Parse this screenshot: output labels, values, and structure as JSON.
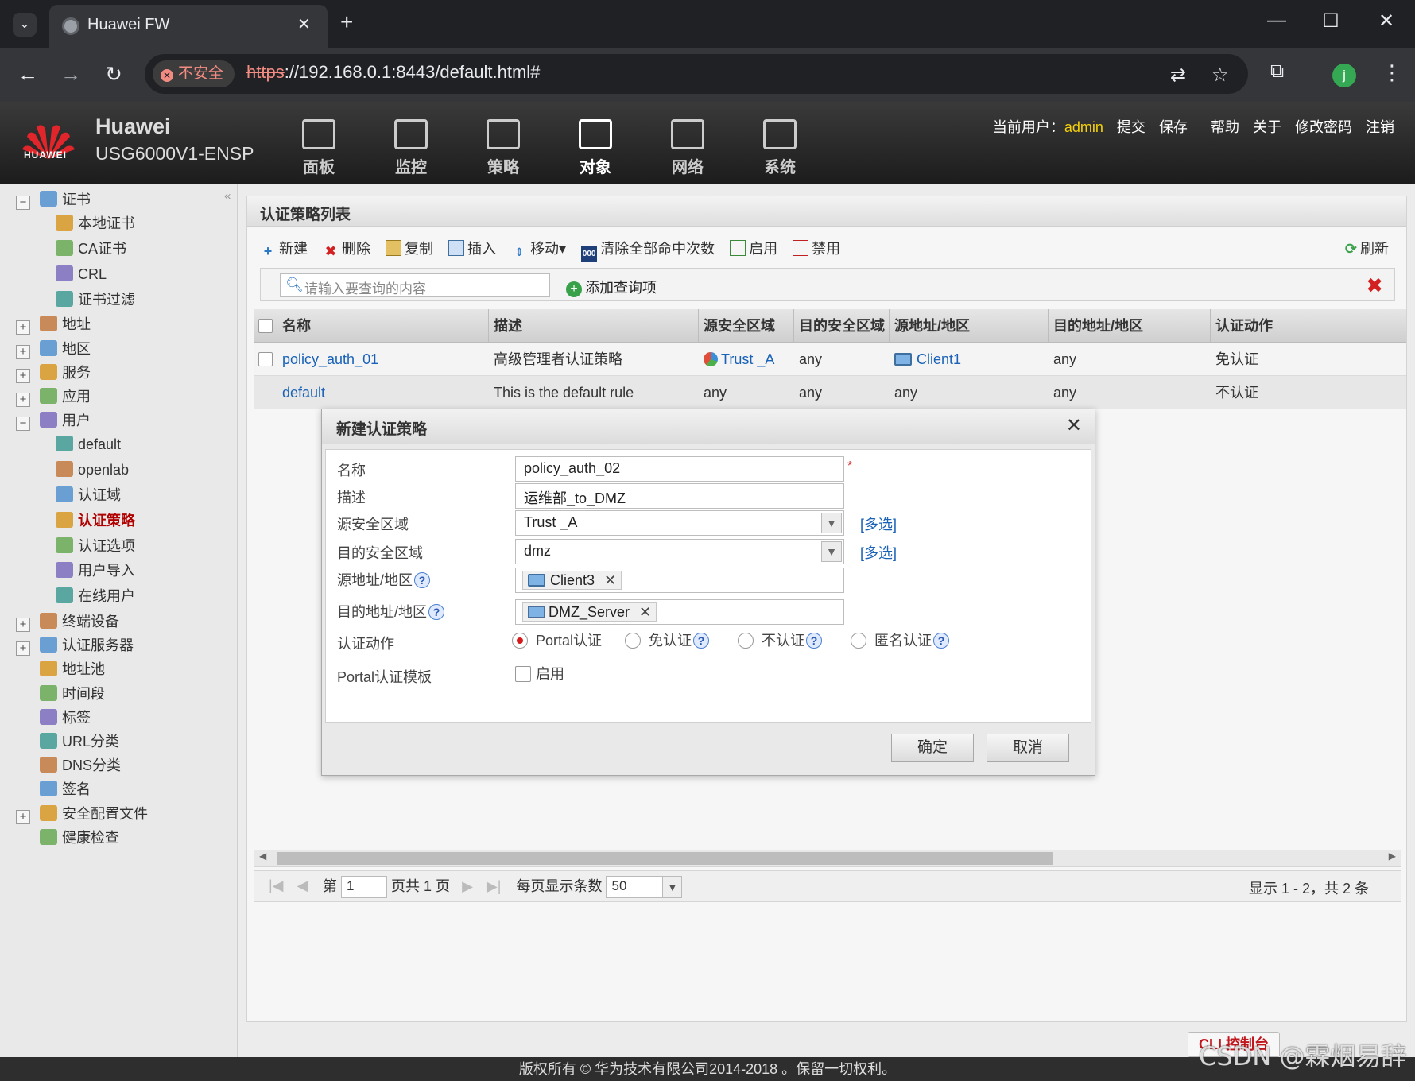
{
  "browser": {
    "tab_title": "Huawei FW",
    "new_tab": "+",
    "security_label": "不安全",
    "url_scheme": "https",
    "url_rest": "://192.168.0.1:8443/default.html#",
    "avatar_letter": "j"
  },
  "header": {
    "logo_text": "HUAWEI",
    "brand_line1": "Huawei",
    "brand_line2": "USG6000V1-ENSP",
    "menu": [
      {
        "label": "面板",
        "icon": "dashboard-icon"
      },
      {
        "label": "监控",
        "icon": "monitor-icon"
      },
      {
        "label": "策略",
        "icon": "policy-icon"
      },
      {
        "label": "对象",
        "icon": "object-icon",
        "active": true
      },
      {
        "label": "网络",
        "icon": "network-icon"
      },
      {
        "label": "系统",
        "icon": "system-icon"
      }
    ],
    "current_user_label": "当前用户：",
    "current_user": "admin",
    "links": [
      "提交",
      "保存",
      "帮助",
      "关于",
      "修改密码",
      "注销"
    ]
  },
  "sidebar": {
    "collapse_glyph": "«",
    "items": [
      {
        "label": "证书",
        "level": 0,
        "expander": "−"
      },
      {
        "label": "本地证书",
        "level": 1
      },
      {
        "label": "CA证书",
        "level": 1
      },
      {
        "label": "CRL",
        "level": 1
      },
      {
        "label": "证书过滤",
        "level": 1
      },
      {
        "label": "地址",
        "level": 0,
        "expander": "+"
      },
      {
        "label": "地区",
        "level": 0,
        "expander": "+"
      },
      {
        "label": "服务",
        "level": 0,
        "expander": "+"
      },
      {
        "label": "应用",
        "level": 0,
        "expander": "+"
      },
      {
        "label": "用户",
        "level": 0,
        "expander": "−"
      },
      {
        "label": "default",
        "level": 1
      },
      {
        "label": "openlab",
        "level": 1
      },
      {
        "label": "认证域",
        "level": 1
      },
      {
        "label": "认证策略",
        "level": 1,
        "selected": true
      },
      {
        "label": "认证选项",
        "level": 1
      },
      {
        "label": "用户导入",
        "level": 1
      },
      {
        "label": "在线用户",
        "level": 1
      },
      {
        "label": "终端设备",
        "level": 0,
        "expander": "+"
      },
      {
        "label": "认证服务器",
        "level": 0,
        "expander": "+"
      },
      {
        "label": "地址池",
        "level": 0
      },
      {
        "label": "时间段",
        "level": 0
      },
      {
        "label": "标签",
        "level": 0
      },
      {
        "label": "URL分类",
        "level": 0
      },
      {
        "label": "DNS分类",
        "level": 0
      },
      {
        "label": "签名",
        "level": 0
      },
      {
        "label": "安全配置文件",
        "level": 0,
        "expander": "+"
      },
      {
        "label": "健康检查",
        "level": 0
      }
    ]
  },
  "panel": {
    "title": "认证策略列表",
    "toolbar": [
      "新建",
      "删除",
      "复制",
      "插入",
      "移动▾",
      "清除全部命中次数",
      "启用",
      "禁用"
    ],
    "refresh": "刷新",
    "search_placeholder": "请输入要查询的内容",
    "add_query": "添加查询项",
    "columns": [
      "名称",
      "描述",
      "源安全区域",
      "目的安全区域",
      "源地址/地区",
      "目的地址/地区",
      "认证动作"
    ],
    "rows": [
      {
        "name": "policy_auth_01",
        "desc": "高级管理者认证策略",
        "src_zone": "Trust _A",
        "dst_zone": "any",
        "src_addr": "Client1",
        "dst_addr": "any",
        "action": "免认证"
      },
      {
        "name": "default",
        "desc": "This is the default rule",
        "src_zone": "any",
        "dst_zone": "any",
        "src_addr": "any",
        "dst_addr": "any",
        "action": "不认证"
      }
    ],
    "pager": {
      "page_prefix": "第",
      "page_value": "1",
      "page_suffix": "页共 1 页",
      "per_page_label": "每页显示条数",
      "per_page_value": "50",
      "total": "显示 1 - 2，共 2 条"
    }
  },
  "dialog": {
    "title": "新建认证策略",
    "fields": {
      "name_label": "名称",
      "name_value": "policy_auth_02",
      "desc_label": "描述",
      "desc_value": "运维部_to_DMZ",
      "src_zone_label": "源安全区域",
      "src_zone_value": "Trust _A",
      "dst_zone_label": "目的安全区域",
      "dst_zone_value": "dmz",
      "multi_select": "[多选]",
      "src_addr_label": "源地址/地区",
      "src_addr_tag": "Client3",
      "dst_addr_label": "目的地址/地区",
      "dst_addr_tag": "DMZ_Server",
      "action_label": "认证动作",
      "actions": [
        "Portal认证",
        "免认证",
        "不认证",
        "匿名认证"
      ],
      "selected_action": "Portal认证",
      "portal_tpl_label": "Portal认证模板",
      "portal_tpl_check": "启用"
    },
    "ok": "确定",
    "cancel": "取消"
  },
  "footer": {
    "cli": "CLI 控制台",
    "copyright": "版权所有 © 华为技术有限公司2014-2018 。保留一切权利。",
    "watermark": "CSDN @霖烟易辞"
  }
}
